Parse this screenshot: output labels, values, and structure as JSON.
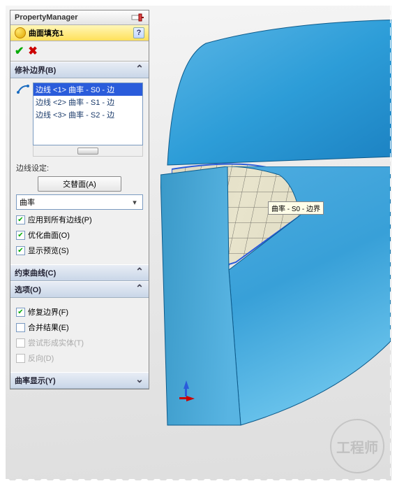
{
  "header": {
    "title": "PropertyManager"
  },
  "feature": {
    "title": "曲面填充1",
    "help": "?"
  },
  "groups": {
    "patch": {
      "title": "修补边界(B)",
      "edges": [
        {
          "text": "边线 <1> 曲率 - S0 - 边",
          "selected": true
        },
        {
          "text": "边线 <2> 曲率 - S1 - 边",
          "selected": false
        },
        {
          "text": "边线 <3> 曲率 - S2 - 边",
          "selected": false
        }
      ],
      "edge_label": "边线设定:",
      "alternate_btn": "交替面(A)",
      "continuity": "曲率",
      "cb_apply_all": "应用到所有边线(P)",
      "cb_optimize": "优化曲面(O)",
      "cb_preview": "显示预览(S)"
    },
    "constraint": {
      "title": "约束曲线(C)"
    },
    "options": {
      "title": "选项(O)",
      "cb_fix": "修复边界(F)",
      "cb_merge": "合并结果(E)",
      "cb_solid": "尝试形成实体(T)",
      "cb_reverse": "反向(D)"
    },
    "curvature": {
      "title": "曲率显示(Y)"
    }
  },
  "tooltip3d": "曲率 - S0 - 边界",
  "watermark": "工程师"
}
